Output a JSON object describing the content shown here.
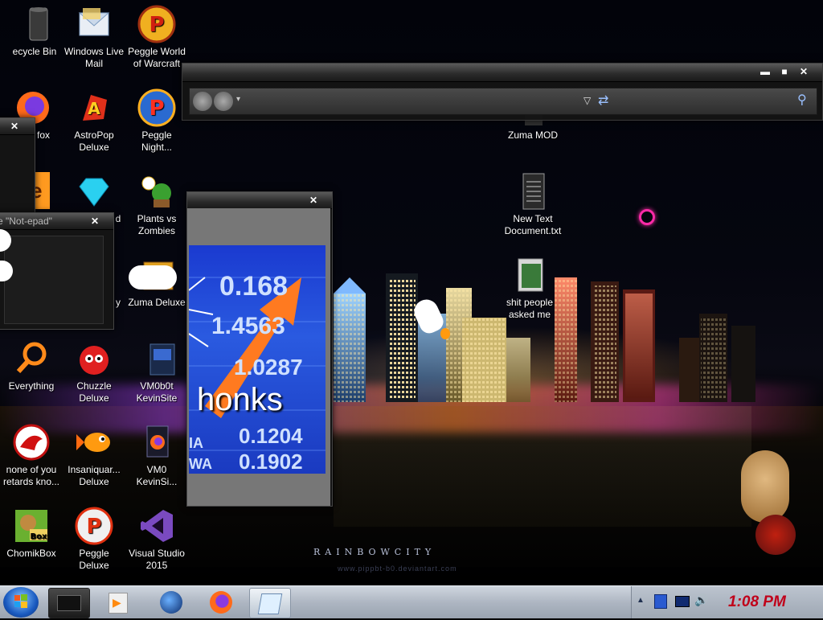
{
  "desktop": {
    "icons": [
      {
        "label": "ecycle Bin"
      },
      {
        "label": "Windows Live Mail"
      },
      {
        "label": "Peggle World of Warcraft"
      },
      {
        "label": "fox"
      },
      {
        "label": "AstroPop Deluxe"
      },
      {
        "label": "Peggle Night..."
      },
      {
        "label": "d"
      },
      {
        "label": "Plants vs Zombies"
      },
      {
        "label": "y"
      },
      {
        "label": "Zuma Deluxe"
      },
      {
        "label": "Everything"
      },
      {
        "label": "Chuzzle Deluxe"
      },
      {
        "label": "VM0b0t KevinSite"
      },
      {
        "label": "none of you retards kno..."
      },
      {
        "label": "Insaniquar... Deluxe"
      },
      {
        "label": "VM0 KevinSi..."
      },
      {
        "label": "ChomikBox"
      },
      {
        "label": "Peggle Deluxe"
      },
      {
        "label": "Visual Studio 2015"
      },
      {
        "label": "Zuma MOD"
      },
      {
        "label": "New Text Document.txt"
      },
      {
        "label": "shit people asked me"
      }
    ],
    "wallpaper_brand": "RAINBOWCITY",
    "wallpaper_sub": "www.pippbt-b0.deviantart.com"
  },
  "notepad_window": {
    "title": "e \"Not-epad\""
  },
  "meme_window": {
    "caption": "honks",
    "numbers": [
      "0.168",
      "1.4563",
      "1.0287",
      "0.1204",
      "0.1902"
    ],
    "tickers": [
      "A",
      "IA",
      "WA"
    ]
  },
  "explorer": {
    "search_icon": "magnifier"
  },
  "taskbar": {
    "clock": "1:08 PM"
  },
  "colors": {
    "clock": "#c0001a",
    "taskbar": "#b4bcc8"
  }
}
